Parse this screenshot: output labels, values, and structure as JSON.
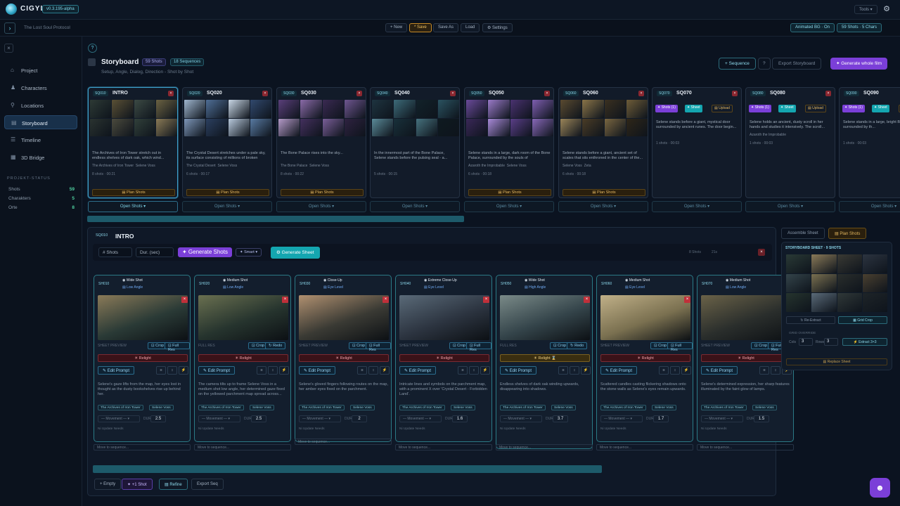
{
  "app": {
    "name": "CIGYL",
    "version": "v0.3.195-alpha",
    "tools": "Tools ▾",
    "project": "The Lost Soul Protocol"
  },
  "toolbar": {
    "new": "+ New",
    "save": "* Save",
    "save_as": "Save As",
    "load": "Load",
    "settings": "⚙ Settings",
    "animated": "Animated BG · On",
    "counts": "59 Shots · 5 Chars"
  },
  "sidebar": {
    "items": [
      {
        "label": "Project",
        "icon": "⌂"
      },
      {
        "label": "Characters",
        "icon": "♟"
      },
      {
        "label": "Locations",
        "icon": "⚲"
      },
      {
        "label": "Storyboard",
        "icon": "▤"
      },
      {
        "label": "Timeline",
        "icon": "☰"
      },
      {
        "label": "3D Bridge",
        "icon": "▦"
      }
    ],
    "status_title": "PROJEKT-STATUS",
    "stats": [
      {
        "label": "Shots",
        "value": "59"
      },
      {
        "label": "Charakters",
        "value": "5"
      },
      {
        "label": "Orte",
        "value": "8"
      }
    ]
  },
  "storyboard": {
    "title": "Storyboard",
    "shots_chip": "59 Shots",
    "seq_chip": "18 Sequences",
    "subtitle": "Setup, Angle, Dialog, Direction - Shot by Shot",
    "add_sequence": "+ Sequence",
    "help": "?",
    "export": "Export Storyboard",
    "generate_film": "✦ Generate whole film"
  },
  "sequences": [
    {
      "code": "SQ010",
      "name": "INTRO",
      "desc": "The Archives of Iron Tower stretch out in endless shelves of dark oak, which wind...",
      "tag1": "The Archives of Iron Tower",
      "tag2": "Selene Voss",
      "meta": "8 shots · 00:21",
      "plan": "▤ Plan Shots",
      "open": "Open Shots ▾",
      "palette": [
        "#2d3a35",
        "#5a5035",
        "#3c4a44",
        "#6b6242",
        "#2a3330",
        "#4b4a3d",
        "#31403a",
        "#8a7a55"
      ]
    },
    {
      "code": "SQ020",
      "name": "SQ020",
      "desc": "The Crystal Desert stretches under a pale sky, its surface consisting of millions of broken",
      "tag1": "The Crystal Desert",
      "tag2": "Selene Voss",
      "meta": "6 shots · 00:17",
      "plan": "▤ Plan Shots",
      "open": "Open Shots ▾",
      "palette": [
        "#9fb6cf",
        "#4f6e96",
        "#c9d7e6",
        "#31496e",
        "#7d96b8",
        "#2b3f5f",
        "#b8c9dc",
        "#587aa2"
      ]
    },
    {
      "code": "SQ030",
      "name": "SQ030",
      "desc": "The Bone Palace rises into the sky...",
      "tag1": "The Bone Palace",
      "tag2": "Selene Voss",
      "meta": "8 shots · 00:22",
      "plan": "▤ Plan Shots",
      "open": "Open Shots ▾",
      "palette": [
        "#5a3f7a",
        "#8a6aa8",
        "#3a2a52",
        "#6f5690",
        "#b49ac8",
        "#44305e",
        "#7a5e98",
        "#2e2240"
      ]
    },
    {
      "code": "SQ040",
      "name": "SQ040",
      "desc": "In the innermost part of the Bone Palace, Selene stands before the pulsing seal - a...",
      "tag1": "",
      "tag2": "",
      "meta": "5 shots · 00:15",
      "plan": "",
      "open": "Open Shots ▾",
      "palette": [
        "#1e3440",
        "#3c6a78",
        "#12222a",
        "#2a5260",
        "#5a8a98",
        "#18303a",
        "#46727e",
        "#0e1a20"
      ]
    },
    {
      "code": "SQ050",
      "name": "SQ050",
      "desc": "Selene stands in a large, dark room of the Bone Palace, surrounded by the souls of",
      "tag1": "Azaroth the Improbable",
      "tag2": "Selene Voss",
      "meta": "6 shots · 00:18",
      "plan": "▤ Plan Shots",
      "open": "Open Shots ▾",
      "palette": [
        "#6a4a9a",
        "#9a7ac8",
        "#4a3270",
        "#7e5eb0",
        "#3a2858",
        "#a88ad8",
        "#5a3e88",
        "#8868b8"
      ]
    },
    {
      "code": "SQ060",
      "name": "SQ060",
      "desc": "Selene stands before a giant, ancient set of scales that sits enthroned in the center of the...",
      "tag1": "Selene Voss",
      "tag2": "Zeta",
      "meta": "6 shots · 00:18",
      "plan": "▤ Plan Shots",
      "open": "Open Shots ▾",
      "palette": [
        "#5a4a30",
        "#8a7448",
        "#3a3020",
        "#6e5c38",
        "#9a8458",
        "#4a3c26",
        "#7a6640",
        "#2e2618"
      ]
    },
    {
      "code": "SQ070",
      "name": "SQ070",
      "desc": "Selene stands before a giant, mystical door surrounded by ancient runes. The door begin...",
      "tag1": "",
      "tag2": "",
      "meta": "1 shots · 00:03",
      "plan": "",
      "open": "Open Shots ▾",
      "palette": []
    },
    {
      "code": "SQ080",
      "name": "SQ080",
      "desc": "Selene holds an ancient, dusty scroll in her hands and studies it intensively. The scroll...",
      "tag1": "Azaroth the Improbable",
      "tag2": "",
      "meta": "1 shots · 00:03",
      "plan": "",
      "open": "Open Shots ▾",
      "palette": []
    },
    {
      "code": "SQ090",
      "name": "SQ090",
      "desc": "Selene stands in a large, bright Bone Palace, surrounded by th...",
      "tag1": "",
      "tag2": "",
      "meta": "1 shots · 00:03",
      "plan": "",
      "open": "Open Shots ▾",
      "palette": []
    }
  ],
  "seq_buttons": {
    "shots": "✦ Shots (1)",
    "sheet": "✦ Sheet",
    "upload": "▤ Upload",
    "gen_shots": "Generate Shots",
    "gen_sheet": "Gen Sheet"
  },
  "panel": {
    "code": "SQ010",
    "title": "INTRO",
    "shots_placeholder": "# Shots",
    "dur_placeholder": "Dur. (sec)",
    "generate": "✦ Generate Shots",
    "smart": "✦ Smart ▾",
    "generate_sheet": "⚙ Generate Sheet",
    "right_small": [
      "8 Shots",
      "21s"
    ],
    "bottom": {
      "empty": "+ Empty",
      "add_shot": "✦ +1 Shot",
      "refine": "▤ Refine",
      "export": "Export Seq"
    }
  },
  "shots": [
    {
      "id": "SH010",
      "type": "◉ Wide Shot",
      "angle": "▤ Low Angle",
      "lbl": "SHEET PREVIEW",
      "b1": "⊡ Crop",
      "b2": "⊡ Full Res",
      "relight": "☀ Relight",
      "text": "Selene's gaze lifts from the map, her eyes lost in thought as the dusty bookshelves rise up behind her.",
      "tag1": "The Archives of Iron Tower",
      "tag2": "Selene Voss",
      "dur": "2.5",
      "ni": "Ni Update Needs",
      "move": "Move to sequence...",
      "c1": "#2a3a36",
      "c2": "#8a7a58"
    },
    {
      "id": "SH020",
      "type": "◉ Medium Shot",
      "angle": "▤ Low Angle",
      "lbl": "FULL RES",
      "b1": "⊡ Crop",
      "b2": "↻ Redo",
      "relight": "☀ Relight",
      "text": "The camera tilts up to frame Selene Voss in a medium shot low angle, her determined gaze fixed on the yellowed parchment map spread across...",
      "tag1": "The Archives of Iron Tower",
      "tag2": "Selene Voss",
      "dur": "2.5",
      "ni": "Ni Update Needs",
      "move": "Move to sequence...",
      "c1": "#26342e",
      "c2": "#6a7050"
    },
    {
      "id": "SH030",
      "type": "◉ Close-Up",
      "angle": "▤ Eye Level",
      "lbl": "SHEET PREVIEW",
      "b1": "⊡ Crop",
      "b2": "⊡ Full Res",
      "relight": "☀ Relight",
      "text": "Selene's gloved fingers following routes on the map, her amber eyes fixed on the parchment.",
      "tag1": "The Archives of Iron Tower",
      "tag2": "Selene Voss",
      "dur": "2",
      "ni": "Ni Update Needs",
      "move": "Move to sequence...",
      "c1": "#3a3a34",
      "c2": "#b09070"
    },
    {
      "id": "SH040",
      "type": "◉ Extreme Close-Up",
      "angle": "▤ Eye Level",
      "lbl": "SHEET PREVIEW",
      "b1": "⊡ Crop",
      "b2": "⊡ Full Res",
      "relight": "☀ Relight",
      "text": "Intricate lines and symbols on the parchment map, with a prominent X over 'Crystal Desert - Forbidden Land'.",
      "tag1": "The Archives of Iron Tower",
      "tag2": "Selene Voss",
      "dur": "1.6",
      "ni": "Ni Update Needs",
      "move": "Move to sequence...",
      "c1": "#2c3440",
      "c2": "#5a6a78"
    },
    {
      "id": "SH050",
      "type": "◉ Wide Shot",
      "angle": "▤ High Angle",
      "lbl": "FULL RES",
      "b1": "⊡ Crop",
      "b2": "↻ Redo",
      "relight": "☀ Relight ⌛",
      "text": "Endless shelves of dark oak winding upwards, disappearing into shadows.",
      "tag1": "The Archives of Iron Tower",
      "tag2": "Selene Voss",
      "dur": "3.7",
      "ni": "Ni Update Needs",
      "move": "Move to sequence...",
      "c1": "#34444a",
      "c2": "#7a8a88"
    },
    {
      "id": "SH060",
      "type": "◉ Medium Shot",
      "angle": "▤ Eye Level",
      "lbl": "SHEET PREVIEW",
      "b1": "⊡ Crop",
      "b2": "⊡ Full Res",
      "relight": "☀ Relight",
      "text": "Scattered candles casting flickering shadows onto the stone walls as Selene's eyes remain upwards.",
      "tag1": "The Archives of Iron Tower",
      "tag2": "Selene Voss",
      "dur": "1.7",
      "ni": "Ni Update Needs",
      "move": "Move to sequence...",
      "c1": "#7a7050",
      "c2": "#c0b088"
    },
    {
      "id": "SH070",
      "type": "◉ Medium Shot",
      "angle": "▤ Low Angle",
      "lbl": "SHEET PREVIEW",
      "b1": "⊡ Crop",
      "b2": "⊡ Full Res",
      "relight": "☀ Relight",
      "text": "Selene's determined expression, her sharp features illuminated by the faint glow of lamps.",
      "tag1": "The Archives of Iron Tower",
      "tag2": "Selene Voss",
      "dur": "1.5",
      "ni": "Ni Update Needs",
      "move": "Move to sequence...",
      "c1": "#2a2e2c",
      "c2": "#6a6248"
    }
  ],
  "sheet_panel": {
    "tab1": "Assemble Sheet",
    "tab2": "▤ Plan Shots",
    "title": "STORYBOARD SHEET · 9 SHOTS",
    "reextract": "↻ Re-Extract",
    "gridcrop": "▦ Grid Crop",
    "override": "GRID OVERRIDE",
    "cols_label": "Cols",
    "cols": "3",
    "rows_label": "Rows",
    "rows": "3",
    "extract": "⚡ Extract 3×3",
    "replace": "▤ Replace Sheet"
  }
}
